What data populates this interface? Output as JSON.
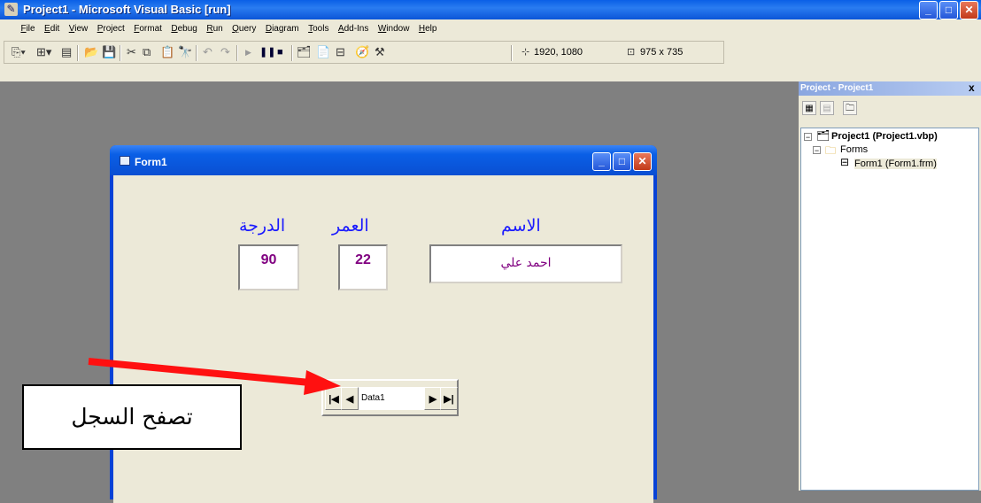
{
  "window": {
    "title": "Project1 - Microsoft Visual Basic [run]"
  },
  "menu": [
    "File",
    "Edit",
    "View",
    "Project",
    "Format",
    "Debug",
    "Run",
    "Query",
    "Diagram",
    "Tools",
    "Add-Ins",
    "Window",
    "Help"
  ],
  "toolbar": {
    "position_readout": "1920, 1080",
    "size_readout": "975 x 735"
  },
  "form": {
    "title": "Form1",
    "labels": {
      "name": "الاسم",
      "age": "العمر",
      "grade": "الدرجة"
    },
    "values": {
      "name": "احمد علي",
      "age": "22",
      "grade": "90"
    },
    "data_control": {
      "caption": "Data1"
    }
  },
  "project_explorer": {
    "title": "Project - Project1",
    "close": "x",
    "tree": {
      "project": "Project1 (Project1.vbp)",
      "folder": "Forms",
      "form": "Form1 (Form1.frm)"
    }
  },
  "annotation": {
    "text": "تصفح السجل"
  }
}
